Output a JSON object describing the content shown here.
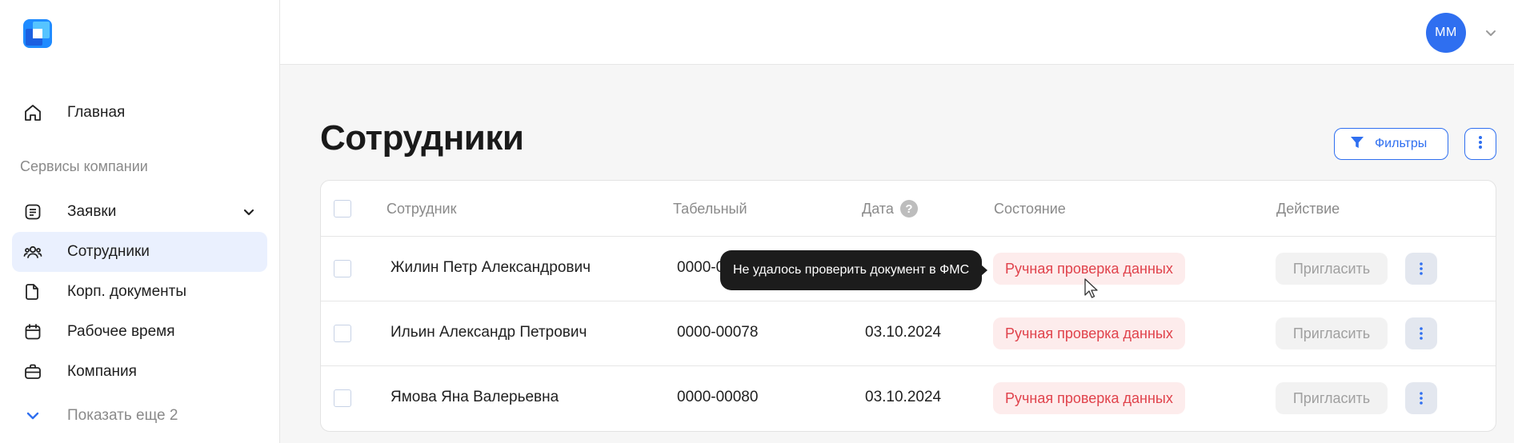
{
  "sidebar": {
    "items": [
      {
        "label": "Главная",
        "icon": "home-icon"
      },
      {
        "label": "Заявки",
        "icon": "list-icon"
      },
      {
        "label": "Сотрудники",
        "icon": "users-icon"
      },
      {
        "label": "Корп. документы",
        "icon": "document-icon"
      },
      {
        "label": "Рабочее время",
        "icon": "calendar-icon"
      },
      {
        "label": "Компания",
        "icon": "briefcase-icon"
      }
    ],
    "section_label": "Сервисы компании",
    "show_more": "Показать еще 2"
  },
  "header": {
    "avatar_initials": "ММ"
  },
  "main": {
    "title": "Сотрудники",
    "filters_label": "Фильтры",
    "columns": {
      "employee": "Сотрудник",
      "tab_number": "Табельный",
      "date": "Дата",
      "state": "Состояние",
      "action": "Действие"
    },
    "rows": [
      {
        "name": "Жилин Петр Александрович",
        "tab_number": "0000-0",
        "date": "",
        "state": "Ручная проверка данных",
        "action": "Пригласить"
      },
      {
        "name": "Ильин Александр Петрович",
        "tab_number": "0000-00078",
        "date": "03.10.2024",
        "state": "Ручная проверка данных",
        "action": "Пригласить"
      },
      {
        "name": "Ямова Яна Валерьевна",
        "tab_number": "0000-00080",
        "date": "03.10.2024",
        "state": "Ручная проверка данных",
        "action": "Пригласить"
      }
    ],
    "tooltip": "Не удалось проверить документ в ФМС"
  },
  "colors": {
    "accent": "#2f6ff0",
    "status_text": "#e0424b",
    "status_bg": "#fdecec",
    "active_nav_bg": "#eaf0fe"
  }
}
